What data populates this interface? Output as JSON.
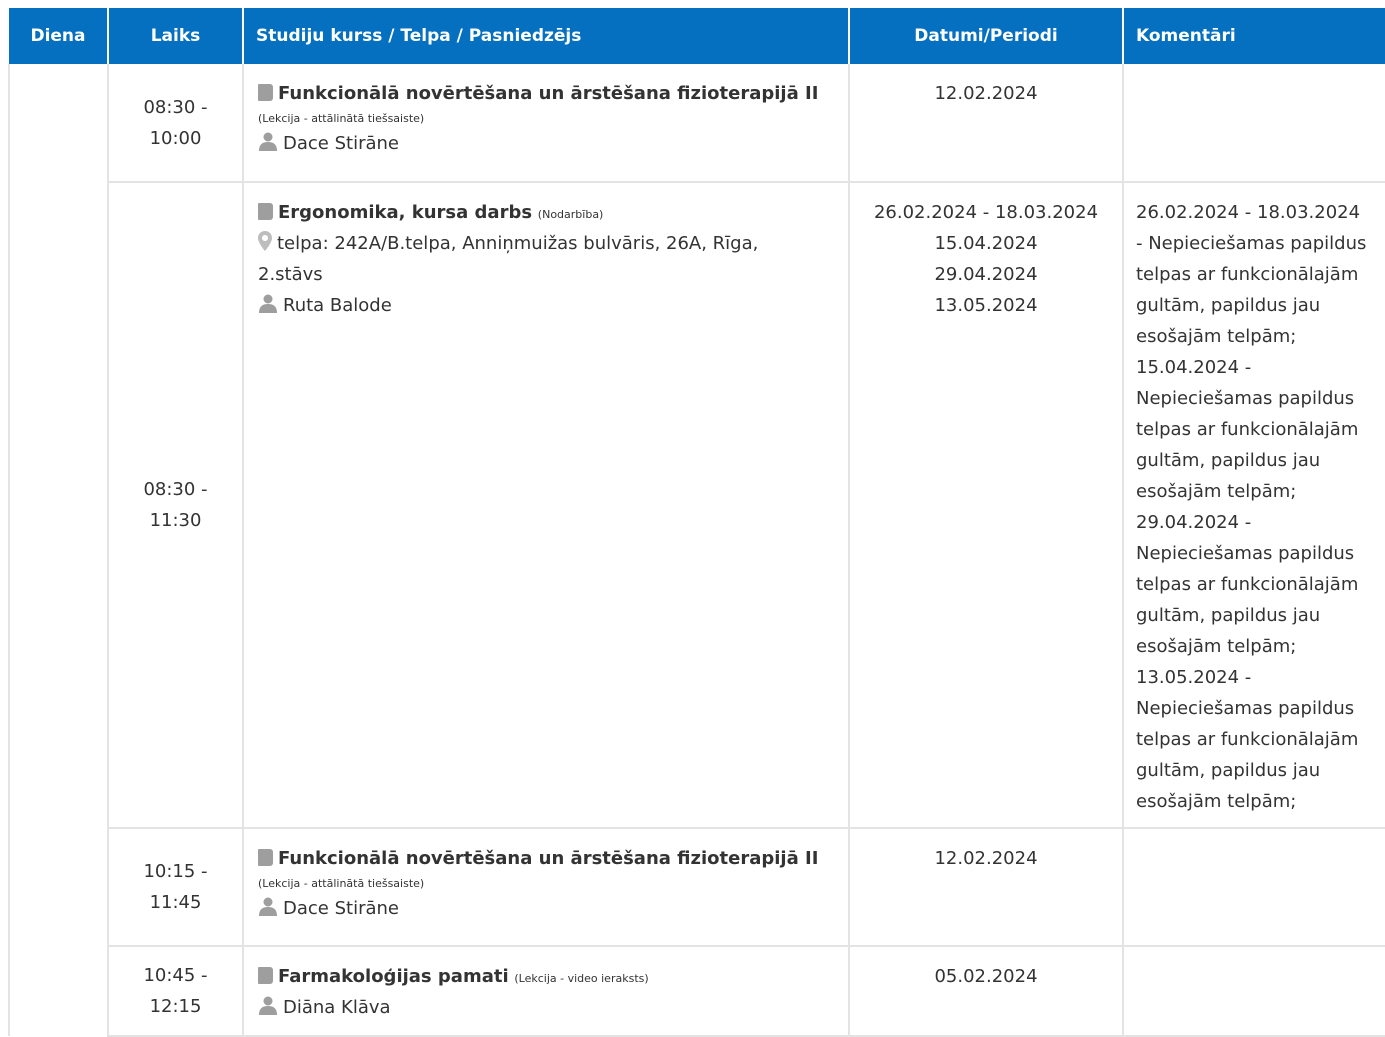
{
  "headers": {
    "day": "Diena",
    "time": "Laiks",
    "course": "Studiju kurss / Telpa / Pasniedzējs",
    "dates": "Datumi/Periodi",
    "comments": "Komentāri"
  },
  "rows": [
    {
      "time_start": "08:30 -",
      "time_end": "10:00",
      "course_title": "Funkcionālā novērtēšana un ārstēšana fizioterapijā II",
      "course_type": "(Lekcija - attālinātā tiešsaiste)",
      "teacher": "Dace Stirāne",
      "dates": [
        "12.02.2024"
      ]
    },
    {
      "time_start": "08:30 -",
      "time_end": "11:30",
      "course_title": "Ergonomika, kursa darbs",
      "course_type": "(Nodarbība)",
      "room_line1": "telpa: 242A/B.telpa, Anniņmuižas bulvāris, 26A, Rīga,",
      "room_line2": "2.stāvs",
      "teacher": "Ruta Balode",
      "dates": [
        "26.02.2024 - 18.03.2024",
        "15.04.2024",
        "29.04.2024",
        "13.05.2024"
      ],
      "comments": [
        "26.02.2024 - 18.03.2024",
        "- Nepieciešamas papildus",
        "telpas ar funkcionālajām",
        "gultām, papildus jau",
        "esošajām telpām;",
        "15.04.2024 -",
        "Nepieciešamas papildus",
        "telpas ar funkcionālajām",
        "gultām, papildus jau",
        "esošajām telpām;",
        "29.04.2024 -",
        "Nepieciešamas papildus",
        "telpas ar funkcionālajām",
        "gultām, papildus jau",
        "esošajām telpām;",
        "13.05.2024 -",
        "Nepieciešamas papildus",
        "telpas ar funkcionālajām",
        "gultām, papildus jau",
        "esošajām telpām;"
      ]
    },
    {
      "time_start": "10:15 -",
      "time_end": "11:45",
      "course_title": "Funkcionālā novērtēšana un ārstēšana fizioterapijā II",
      "course_type": "(Lekcija - attālinātā tiešsaiste)",
      "teacher": "Dace Stirāne",
      "dates": [
        "12.02.2024"
      ]
    },
    {
      "time_start": "10:45 -",
      "time_end": "12:15",
      "course_title": "Farmakoloģijas pamati",
      "course_type": "(Lekcija - video ieraksts)",
      "teacher": "Diāna Klāva",
      "dates": [
        "05.02.2024"
      ]
    }
  ],
  "colors": {
    "header_bg": "#0570c0",
    "header_text": "#ffffff",
    "border": "#e3e3e3",
    "icon": "#9e9e9e"
  }
}
